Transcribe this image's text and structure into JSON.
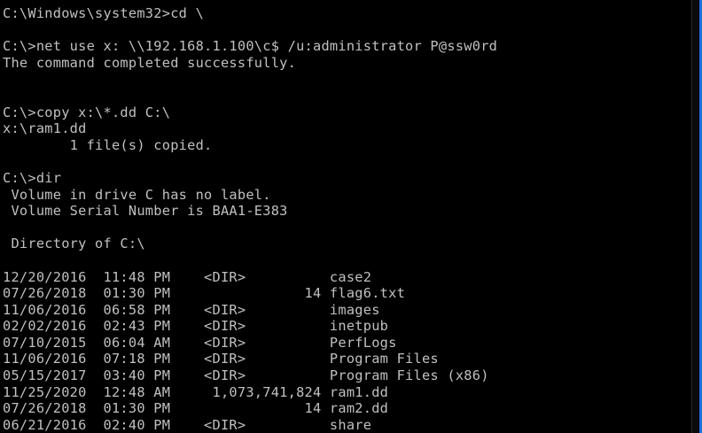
{
  "console": {
    "lines": [
      "C:\\Windows\\system32>cd \\",
      "",
      "C:\\>net use x: \\\\192.168.1.100\\c$ /u:administrator P@ssw0rd",
      "The command completed successfully.",
      "",
      "",
      "C:\\>copy x:\\*.dd C:\\",
      "x:\\ram1.dd",
      "        1 file(s) copied.",
      "",
      "C:\\>dir",
      " Volume in drive C has no label.",
      " Volume Serial Number is BAA1-E383",
      "",
      " Directory of C:\\",
      "",
      "12/20/2016  11:48 PM    <DIR>          case2",
      "07/26/2018  01:30 PM                14 flag6.txt",
      "11/06/2016  06:58 PM    <DIR>          images",
      "02/02/2016  02:43 PM    <DIR>          inetpub",
      "07/10/2015  06:04 AM    <DIR>          PerfLogs",
      "11/06/2016  07:18 PM    <DIR>          Program Files",
      "05/15/2017  03:40 PM    <DIR>          Program Files (x86)",
      "11/25/2020  12:48 AM     1,073,741,824 ram1.dd",
      "07/26/2018  01:30 PM                14 ram2.dd",
      "06/21/2016  02:40 PM    <DIR>          share"
    ]
  },
  "colors": {
    "background": "#000000",
    "text": "#c0c0c0",
    "window_edge": "#1e6fd9"
  }
}
